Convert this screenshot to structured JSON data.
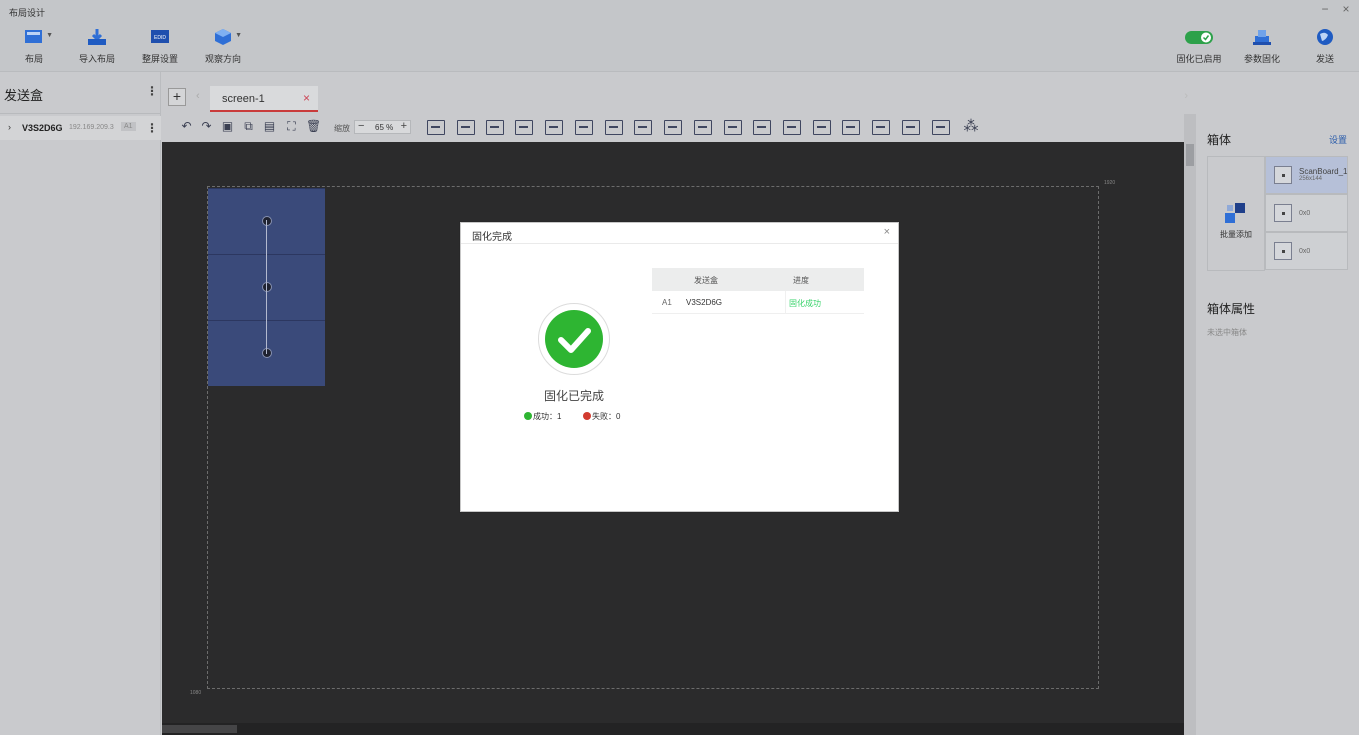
{
  "window": {
    "title": "布局设计",
    "minimize": "−",
    "close": "×"
  },
  "ribbon": {
    "left": [
      {
        "label": "布局",
        "icon": "layout-icon",
        "dropdown": true
      },
      {
        "label": "导入布局",
        "icon": "import-layout-icon"
      },
      {
        "label": "整屏设置",
        "icon": "edid-icon",
        "icon_text": "EDID"
      },
      {
        "label": "观察方向",
        "icon": "cube-view-icon",
        "dropdown": true
      }
    ],
    "right": [
      {
        "label": "固化已启用",
        "icon": "toggle-on-icon"
      },
      {
        "label": "参数固化",
        "icon": "solidify-icon"
      },
      {
        "label": "发送",
        "icon": "globe-send-icon"
      }
    ]
  },
  "left_panel": {
    "title": "发送盒",
    "device": {
      "name": "V3S2D6G",
      "ip": "192.169.209.3",
      "port": "A1"
    }
  },
  "tabs": {
    "add": "+",
    "items": [
      {
        "label": "screen-1",
        "close": "×"
      }
    ]
  },
  "toolbar": {
    "zoom_label": "缩放",
    "zoom_value": "65 %",
    "zoom_minus": "−",
    "zoom_plus": "+"
  },
  "canvas": {
    "width_label": "1920",
    "height_label": "1080"
  },
  "right_panel": {
    "cabinet_title": "箱体",
    "settings_link": "设置",
    "batch_add": "批量添加",
    "boards": [
      {
        "name": "ScanBoard_1",
        "size": "256x144",
        "selected": true
      },
      {
        "name": "0x0",
        "size": ""
      },
      {
        "name": "0x0",
        "size": ""
      }
    ],
    "props_title": "箱体属性",
    "props_empty": "未选中箱体"
  },
  "modal": {
    "title": "固化完成",
    "close": "×",
    "status_title": "固化已完成",
    "success_label": "成功：1",
    "fail_label": "失败：0",
    "table": {
      "headers": [
        "发送盒",
        "进度"
      ],
      "rows": [
        {
          "port": "A1",
          "device": "V3S2D6G",
          "progress": "固化成功"
        }
      ]
    }
  },
  "colors": {
    "success": "#2eb532",
    "error": "#d23b2f",
    "progress_ok": "#39d36b",
    "cabinet": "#3a4a7a",
    "tab_accent": "#c93b3b"
  }
}
